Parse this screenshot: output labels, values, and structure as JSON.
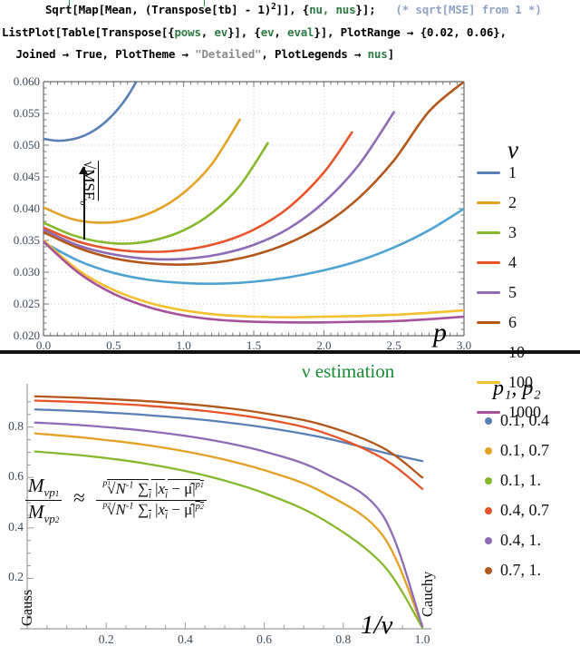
{
  "code": {
    "line1_parts": [
      {
        "t": "   Sqrt[Map[Mean, (Transpose[tb] - 1)",
        "c": "k"
      },
      {
        "t": "2",
        "c": "sup"
      },
      {
        "t": "]], {nu, nus}];",
        "c": "k"
      },
      {
        "t": "   (* sqrt[MSE] from 1 *)",
        "c": "comment"
      }
    ],
    "line1_plain": "   Sqrt[Map[Mean, (Transpose[tb] - 1)^2]], {nu, nus}];",
    "line1_comment": "(* sqrt[MSE] from 1 *)",
    "line2": "ListPlot[Table[Transpose[{pows, ev}], {ev, eval}], PlotRange → {0.02, 0.06},",
    "line3": " Joined → True, PlotTheme → \"Detailed\", PlotLegends → nus]"
  },
  "annotations": {
    "mse_label": "√MSE",
    "mse_subscript": "σ",
    "section_title": "ν estimation",
    "gauss_label": "Gauss",
    "cauchy_label": "Cauchy"
  },
  "chart_data": [
    {
      "type": "line",
      "title": "",
      "xlabel": "p",
      "ylabel": "√MSEσ",
      "xlim": [
        0,
        3
      ],
      "ylim": [
        0.02,
        0.06
      ],
      "xticks": [
        "0.0",
        "0.5",
        "1.0",
        "1.5",
        "2.0",
        "2.5",
        "3.0"
      ],
      "xtick_values": [
        0,
        0.5,
        1.0,
        1.5,
        2.0,
        2.5,
        3.0
      ],
      "yticks": [
        "0.020",
        "0.025",
        "0.030",
        "0.035",
        "0.040",
        "0.045",
        "0.050",
        "0.055",
        "0.060"
      ],
      "ytick_values": [
        0.02,
        0.025,
        0.03,
        0.035,
        0.04,
        0.045,
        0.05,
        0.055,
        0.06
      ],
      "grid": true,
      "legend_title": "ν",
      "legend_position": "right",
      "series": [
        {
          "name": "1",
          "color": "#5a7fb5",
          "x": [
            0.0,
            0.1,
            0.2,
            0.3,
            0.4,
            0.5,
            0.6,
            0.7
          ],
          "values": [
            0.051,
            0.0507,
            0.0509,
            0.0516,
            0.0529,
            0.0549,
            0.0577,
            0.0615
          ]
        },
        {
          "name": "2",
          "color": "#e3a124",
          "x": [
            0.0,
            0.2,
            0.4,
            0.6,
            0.8,
            1.0,
            1.2,
            1.4
          ],
          "values": [
            0.0402,
            0.0384,
            0.0378,
            0.0382,
            0.0397,
            0.0425,
            0.047,
            0.054
          ]
        },
        {
          "name": "3",
          "color": "#86b82c",
          "x": [
            0.0,
            0.2,
            0.4,
            0.6,
            0.8,
            1.0,
            1.2,
            1.4,
            1.6
          ],
          "values": [
            0.0378,
            0.0359,
            0.0348,
            0.0345,
            0.0351,
            0.0366,
            0.0393,
            0.0436,
            0.0503
          ]
        },
        {
          "name": "4",
          "color": "#e8542a",
          "x": [
            0.0,
            0.25,
            0.5,
            0.75,
            1.0,
            1.25,
            1.5,
            1.75,
            2.0,
            2.2
          ],
          "values": [
            0.037,
            0.0348,
            0.0336,
            0.0332,
            0.0335,
            0.0346,
            0.0367,
            0.0402,
            0.0457,
            0.052
          ]
        },
        {
          "name": "5",
          "color": "#8d6bb5",
          "x": [
            0.0,
            0.25,
            0.5,
            0.75,
            1.0,
            1.25,
            1.5,
            1.75,
            2.0,
            2.25,
            2.5
          ],
          "values": [
            0.0367,
            0.0342,
            0.0328,
            0.0321,
            0.0321,
            0.0328,
            0.0343,
            0.0369,
            0.041,
            0.0469,
            0.0552
          ]
        },
        {
          "name": "6",
          "color": "#b3561a",
          "x": [
            0.0,
            0.25,
            0.5,
            0.75,
            1.0,
            1.25,
            1.5,
            1.75,
            2.0,
            2.25,
            2.5,
            2.75,
            3.0
          ],
          "values": [
            0.0363,
            0.0338,
            0.0322,
            0.0314,
            0.0312,
            0.0316,
            0.0327,
            0.0346,
            0.0375,
            0.0417,
            0.0476,
            0.0553,
            0.06
          ]
        },
        {
          "name": "10",
          "color": "#4fa3d1",
          "x": [
            0.0,
            0.25,
            0.5,
            0.75,
            1.0,
            1.25,
            1.5,
            1.75,
            2.0,
            2.25,
            2.5,
            2.75,
            3.0
          ],
          "values": [
            0.0347,
            0.0318,
            0.0299,
            0.0288,
            0.0283,
            0.0282,
            0.0285,
            0.0292,
            0.0303,
            0.0318,
            0.0339,
            0.0366,
            0.04
          ]
        },
        {
          "name": "100",
          "color": "#f5c02e",
          "x": [
            0.0,
            0.25,
            0.5,
            0.75,
            1.0,
            1.25,
            1.5,
            1.75,
            2.0,
            2.25,
            2.5,
            2.75,
            3.0
          ],
          "values": [
            0.035,
            0.0303,
            0.0272,
            0.0252,
            0.024,
            0.0233,
            0.023,
            0.0229,
            0.023,
            0.0231,
            0.0233,
            0.0236,
            0.024
          ]
        },
        {
          "name": "1000",
          "color": "#a6529a",
          "x": [
            0.0,
            0.25,
            0.5,
            0.75,
            1.0,
            1.25,
            1.5,
            1.75,
            2.0,
            2.25,
            2.5,
            2.75,
            3.0
          ],
          "values": [
            0.0348,
            0.0299,
            0.0266,
            0.0245,
            0.0232,
            0.0225,
            0.0222,
            0.0221,
            0.0221,
            0.0222,
            0.0223,
            0.0226,
            0.023
          ]
        }
      ]
    },
    {
      "type": "line",
      "title": "ν estimation",
      "xlabel": "1/ν",
      "ylabel": "",
      "xlim": [
        0,
        1
      ],
      "ylim": [
        0,
        0.95
      ],
      "xticks": [
        "0.2",
        "0.4",
        "0.6",
        "0.8",
        "1.0"
      ],
      "xtick_values": [
        0.2,
        0.4,
        0.6,
        0.8,
        1.0
      ],
      "yticks": [
        "0.2",
        "0.4",
        "0.6",
        "0.8"
      ],
      "ytick_values": [
        0.2,
        0.4,
        0.6,
        0.8
      ],
      "grid": false,
      "legend_title": "p₁, p₂",
      "legend_position": "right",
      "series": [
        {
          "name": "0.1, 0.4",
          "color": "#5a7fb5",
          "x": [
            0.02,
            0.15,
            0.3,
            0.45,
            0.6,
            0.75,
            0.9,
            1.0
          ],
          "values": [
            0.87,
            0.862,
            0.848,
            0.828,
            0.799,
            0.758,
            0.7,
            0.665
          ]
        },
        {
          "name": "0.1, 0.7",
          "color": "#e3a124",
          "x": [
            0.02,
            0.15,
            0.3,
            0.45,
            0.6,
            0.75,
            0.9,
            1.0
          ],
          "values": [
            0.775,
            0.757,
            0.729,
            0.688,
            0.629,
            0.54,
            0.37,
            0.01
          ]
        },
        {
          "name": "0.1, 1.",
          "color": "#86b82c",
          "x": [
            0.02,
            0.15,
            0.3,
            0.45,
            0.6,
            0.75,
            0.9,
            1.0
          ],
          "values": [
            0.703,
            0.686,
            0.655,
            0.608,
            0.538,
            0.432,
            0.255,
            0.005
          ]
        },
        {
          "name": "0.4, 0.7",
          "color": "#e8542a",
          "x": [
            0.02,
            0.15,
            0.3,
            0.45,
            0.6,
            0.75,
            0.9,
            1.0
          ],
          "values": [
            0.905,
            0.898,
            0.885,
            0.864,
            0.832,
            0.778,
            0.676,
            0.555
          ]
        },
        {
          "name": "0.4, 1.",
          "color": "#8d6bb5",
          "x": [
            0.02,
            0.15,
            0.3,
            0.45,
            0.6,
            0.75,
            0.9,
            1.0
          ],
          "values": [
            0.818,
            0.806,
            0.785,
            0.753,
            0.703,
            0.62,
            0.45,
            0.01
          ]
        },
        {
          "name": "0.7, 1.",
          "color": "#b3561a",
          "x": [
            0.02,
            0.15,
            0.3,
            0.45,
            0.6,
            0.75,
            0.9,
            1.0
          ],
          "values": [
            0.922,
            0.915,
            0.903,
            0.885,
            0.855,
            0.808,
            0.718,
            0.6
          ]
        }
      ],
      "formula": "Mνp₁ / Mνp₂ ≈ (p₁√(N⁻¹ Σᵢ |xᵢ - μ̂|^p₁)) / (p₂√(N⁻¹ Σᵢ |xᵢ - μ̂|^p₂))"
    }
  ]
}
